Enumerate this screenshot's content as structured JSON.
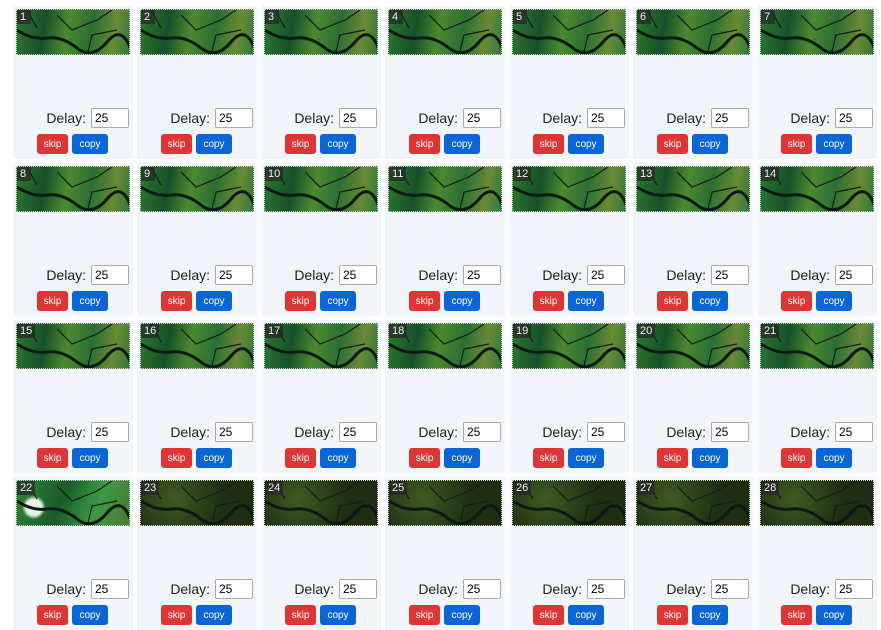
{
  "labels": {
    "delay": "Delay:",
    "skip": "skip",
    "copy": "copy"
  },
  "colors": {
    "skip": "#e03535",
    "copy": "#0a66d6",
    "card_bg": "#f1f5f9"
  },
  "frames": [
    {
      "index": "1",
      "delay": "25"
    },
    {
      "index": "2",
      "delay": "25"
    },
    {
      "index": "3",
      "delay": "25"
    },
    {
      "index": "4",
      "delay": "25"
    },
    {
      "index": "5",
      "delay": "25"
    },
    {
      "index": "6",
      "delay": "25"
    },
    {
      "index": "7",
      "delay": "25"
    },
    {
      "index": "8",
      "delay": "25"
    },
    {
      "index": "9",
      "delay": "25"
    },
    {
      "index": "10",
      "delay": "25"
    },
    {
      "index": "11",
      "delay": "25"
    },
    {
      "index": "12",
      "delay": "25"
    },
    {
      "index": "13",
      "delay": "25"
    },
    {
      "index": "14",
      "delay": "25"
    },
    {
      "index": "15",
      "delay": "25"
    },
    {
      "index": "16",
      "delay": "25"
    },
    {
      "index": "17",
      "delay": "25"
    },
    {
      "index": "18",
      "delay": "25"
    },
    {
      "index": "19",
      "delay": "25"
    },
    {
      "index": "20",
      "delay": "25"
    },
    {
      "index": "21",
      "delay": "25"
    },
    {
      "index": "22",
      "delay": "25"
    },
    {
      "index": "23",
      "delay": "25"
    },
    {
      "index": "24",
      "delay": "25"
    },
    {
      "index": "25",
      "delay": "25"
    },
    {
      "index": "26",
      "delay": "25"
    },
    {
      "index": "27",
      "delay": "25"
    },
    {
      "index": "28",
      "delay": "25"
    }
  ]
}
